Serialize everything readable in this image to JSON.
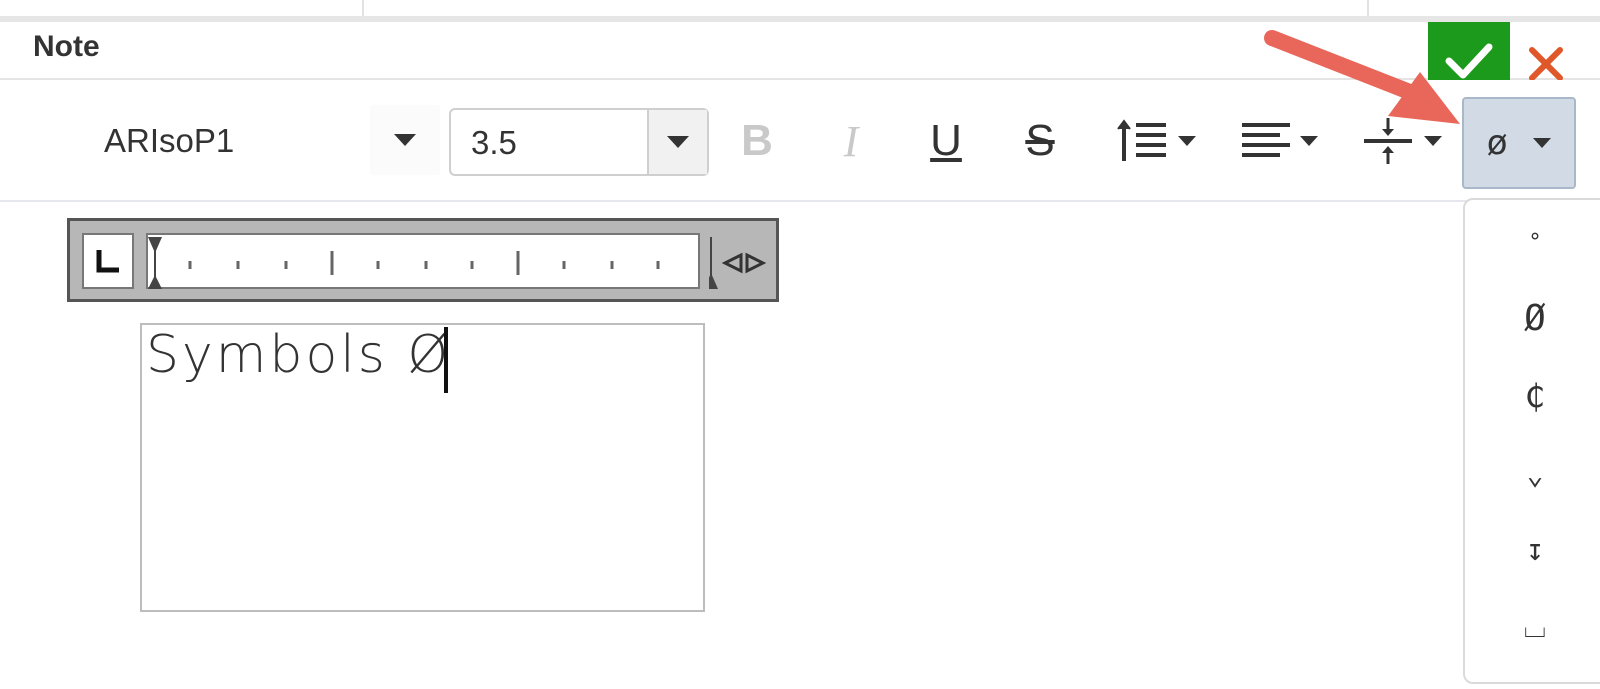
{
  "panel": {
    "title": "Note"
  },
  "toolbar": {
    "font_name": "ARIsoP1",
    "font_size": "3.5",
    "bold_label": "B",
    "italic_label": "I",
    "underline_label": "U",
    "strikethrough_label": "S",
    "symbol_selected": "ø"
  },
  "symbol_menu": {
    "items": [
      "°",
      "Ø",
      "₵",
      "⌄",
      "↧",
      "⌴"
    ]
  },
  "note": {
    "text": "Symbols Ø"
  },
  "colors": {
    "confirm": "#1b9a1b",
    "cancel": "#e0582a",
    "annotation_arrow": "#e8675a",
    "selected_button": "#d2dbe5"
  },
  "icons": [
    "check-icon",
    "close-icon",
    "line-spacing-icon",
    "align-left-icon",
    "vertical-align-icon",
    "chevron-down-icon",
    "tab-stop-icon",
    "ruler-resize-icon"
  ]
}
